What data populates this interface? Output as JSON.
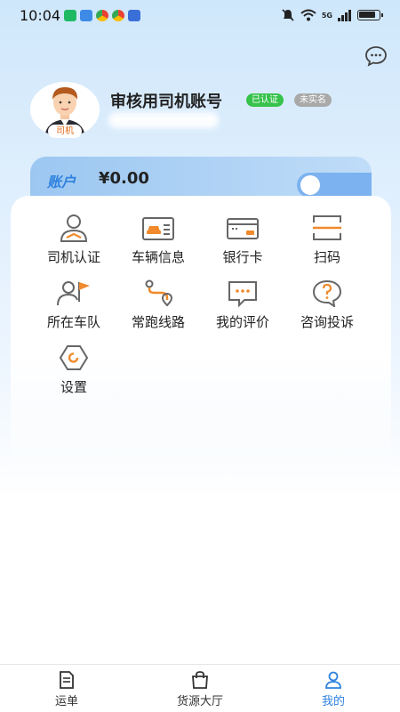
{
  "status_bar": {
    "time": "10:04",
    "network": "5G",
    "notification_icons": [
      "app-notification-icon",
      "usb-icon",
      "browser-icon",
      "browser-icon",
      "download-icon"
    ]
  },
  "header": {
    "message_icon": "chat-bubble-icon"
  },
  "profile": {
    "avatar_tag": "司机",
    "account_name": "审核用司机账号",
    "badge_verified": "已认证",
    "badge_unreal": "未实名"
  },
  "account": {
    "label": "账户",
    "balance": "¥0.00"
  },
  "menu": {
    "items": [
      {
        "label": "司机认证",
        "icon": "driver-certification-icon"
      },
      {
        "label": "车辆信息",
        "icon": "vehicle-info-icon"
      },
      {
        "label": "银行卡",
        "icon": "bank-card-icon"
      },
      {
        "label": "扫码",
        "icon": "scan-icon"
      },
      {
        "label": "所在车队",
        "icon": "fleet-icon"
      },
      {
        "label": "常跑线路",
        "icon": "route-icon"
      },
      {
        "label": "我的评价",
        "icon": "review-icon"
      },
      {
        "label": "咨询投诉",
        "icon": "complaint-icon"
      },
      {
        "label": "设置",
        "icon": "settings-icon"
      }
    ]
  },
  "bottom_nav": {
    "items": [
      {
        "label": "运单",
        "icon": "waybill-icon"
      },
      {
        "label": "货源大厅",
        "icon": "shopping-bag-icon"
      },
      {
        "label": "我的",
        "icon": "user-icon",
        "active": true
      }
    ]
  },
  "colors": {
    "accent": "#2f82df",
    "orange": "#f08a2c",
    "icon_gray": "#666666",
    "verified_green": "#36c24b"
  }
}
